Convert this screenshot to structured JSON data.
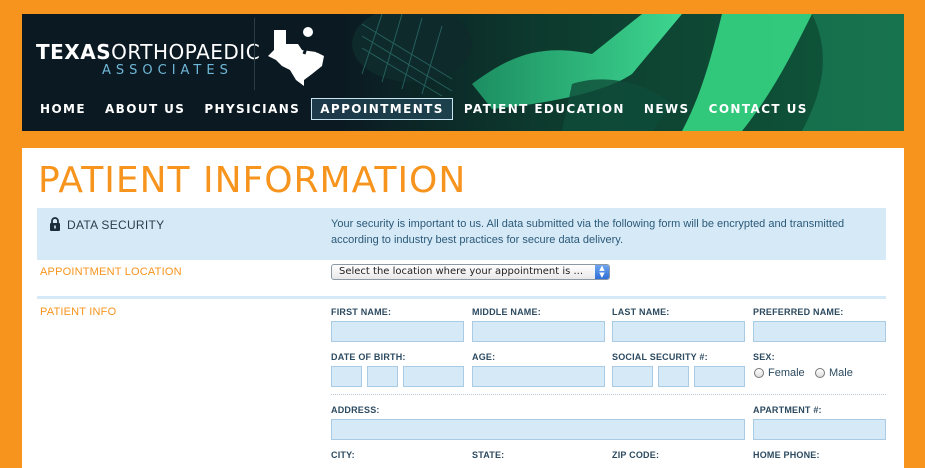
{
  "brand": {
    "name_bold": "TEXAS",
    "name_rest": "ORTHOPAEDIC",
    "subtitle": "ASSOCIATES"
  },
  "nav": {
    "items": [
      "HOME",
      "ABOUT US",
      "PHYSICIANS",
      "APPOINTMENTS",
      "PATIENT EDUCATION",
      "NEWS",
      "CONTACT US"
    ],
    "active": "APPOINTMENTS"
  },
  "page": {
    "title": "PATIENT INFORMATION"
  },
  "security": {
    "label": "DATA SECURITY",
    "text": "Your security is important to us. All data submitted via the following form will be encrypted and transmitted according to industry best practices for secure data delivery."
  },
  "appointment_location": {
    "label": "APPOINTMENT LOCATION",
    "select_value": "Select the location where your appointment is ..."
  },
  "patient_info": {
    "label": "PATIENT INFO",
    "first_name": "FIRST NAME:",
    "middle_name": "MIDDLE NAME:",
    "last_name": "LAST NAME:",
    "preferred_name": "PREFERRED NAME:",
    "dob": "DATE OF BIRTH:",
    "age": "AGE:",
    "ssn": "SOCIAL SECURITY #:",
    "sex": "SEX:",
    "sex_options": [
      "Female",
      "Male"
    ],
    "address": "ADDRESS:",
    "apartment": "APARTMENT #:",
    "city": "CITY:",
    "state": "STATE:",
    "zip": "ZIP CODE:",
    "home_phone": "HOME PHONE:"
  },
  "colors": {
    "page_background": "#f7941d",
    "accent_orange": "#f7941d",
    "field_blue": "#d6e9f6",
    "header_dark": "#0b1a22",
    "photo_green": "#2fe08a"
  }
}
